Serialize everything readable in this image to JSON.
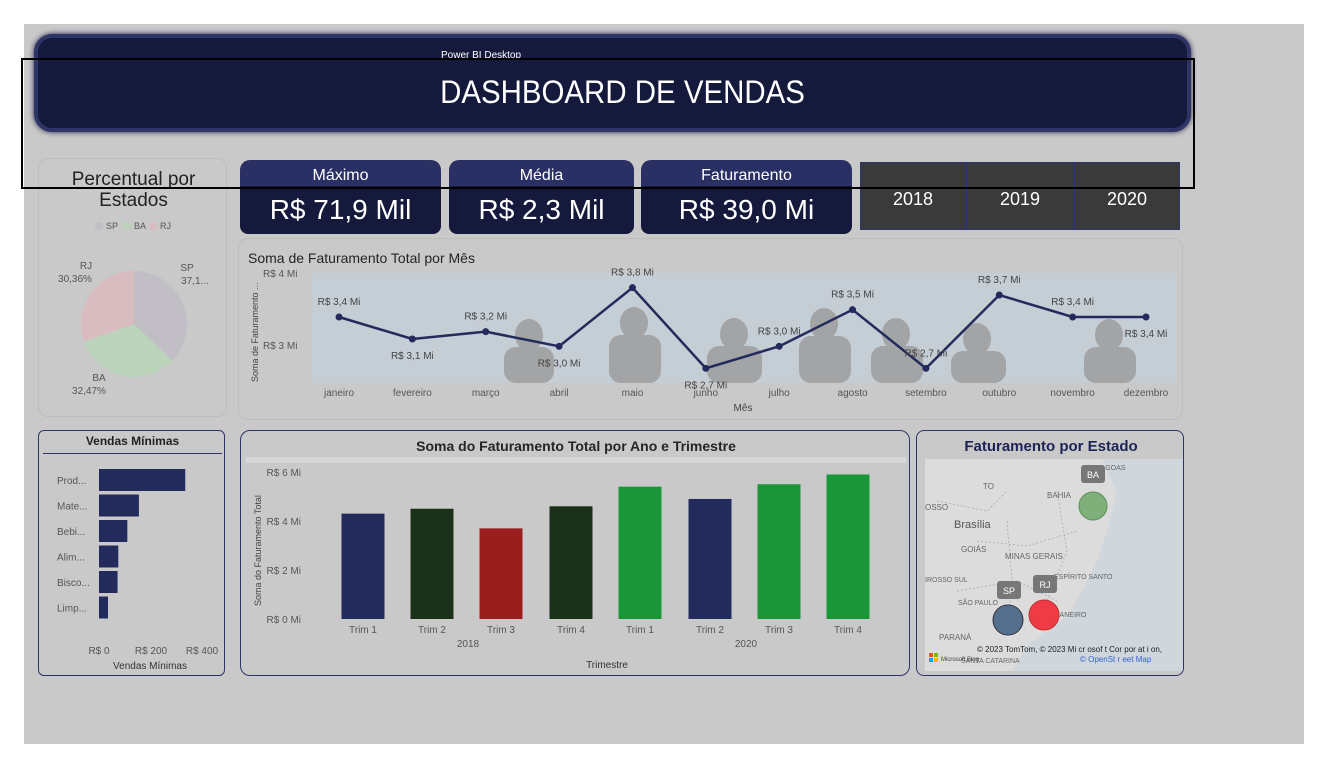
{
  "app": {
    "title": "Power BI Desktop"
  },
  "header": {
    "title": "DASHBOARD DE VENDAS"
  },
  "kpis": [
    {
      "label": "Máximo",
      "value": "R$ 71,9 Mil"
    },
    {
      "label": "Média",
      "value": "R$ 2,3 Mil"
    },
    {
      "label": "Faturamento",
      "value": "R$ 39,0 Mi"
    }
  ],
  "year_slicer": [
    "2018",
    "2019",
    "2020"
  ],
  "colors": {
    "navy": "#232a5c",
    "dark_green": "#1b3019",
    "red": "#9a1e1e",
    "green": "#1a9638",
    "header": "#151a3c"
  },
  "pie": {
    "title": "Percentual por Estados",
    "legend": [
      {
        "name": "SP",
        "color": "#c1bec6"
      },
      {
        "name": "BA",
        "color": "#bcd4bc"
      },
      {
        "name": "RJ",
        "color": "#d8bcbf"
      }
    ],
    "labels": {
      "sp": "SP",
      "sp_value": "37,1...",
      "rj": "RJ",
      "rj_value": "30,36%",
      "ba": "BA",
      "ba_value": "32,47%"
    }
  },
  "line": {
    "title": "Soma de Faturamento Total por Mês",
    "ylabel": "Soma de Faturamento ...",
    "xlabel": "Mês",
    "yticks": [
      "R$ 4 Mi",
      "R$ 3 Mi"
    ]
  },
  "bars_min": {
    "title": "Vendas Mínimas",
    "xlabel": "Vendas Mínimas",
    "xticks": [
      "R$ 0",
      "R$ 200",
      "R$ 400"
    ]
  },
  "bars_tri": {
    "title": "Soma do Faturamento Total por Ano e Trimestre",
    "ylabel": "Soma do Faturamento Total",
    "xlabel": "Trimestre",
    "yticks": [
      "R$ 6 Mi",
      "R$ 4 Mi",
      "R$ 2 Mi",
      "R$ 0 Mi"
    ],
    "years": [
      "2018",
      "2020"
    ]
  },
  "map": {
    "title": "Faturamento por Estado",
    "places": [
      "TO",
      "BAHIA",
      "ALAGOAS",
      "OSSO",
      "Brasília",
      "GOIÁS",
      "MINAS GERAIS",
      "ESPÍRITO SANTO",
      "IROSSO SUL",
      "SÃO PAULO",
      "RIO DE JANEIRO",
      "PARANÁ",
      "SANTA CATARINA"
    ],
    "markers": [
      "BA",
      "SP",
      "RJ"
    ],
    "attribution": "© 2023 TomTom, © 2023 Mi cr osof t Cor por at i on,",
    "osm": "© OpenSt r eet Map",
    "brand": "Microsoft Bing"
  },
  "chart_data": [
    {
      "type": "pie",
      "title": "Percentual por Estados",
      "slices": [
        {
          "name": "SP",
          "value": 37.17
        },
        {
          "name": "BA",
          "value": 32.47
        },
        {
          "name": "RJ",
          "value": 30.36
        }
      ]
    },
    {
      "type": "line",
      "title": "Soma de Faturamento Total por Mês",
      "xlabel": "Mês",
      "ylabel": "Soma de Faturamento ...",
      "categories": [
        "janeiro",
        "fevereiro",
        "março",
        "abril",
        "maio",
        "junho",
        "julho",
        "agosto",
        "setembro",
        "outubro",
        "novembro",
        "dezembro"
      ],
      "values": [
        3.4,
        3.1,
        3.2,
        3.0,
        3.8,
        2.7,
        3.0,
        3.5,
        2.7,
        3.7,
        3.4,
        3.4
      ],
      "value_labels": [
        "R$ 3,4 Mi",
        "R$ 3,1 Mi",
        "R$ 3,2 Mi",
        "R$ 3,0 Mi",
        "R$ 3,8 Mi",
        "R$ 2,7 Mi",
        "R$ 3,0 Mi",
        "R$ 3,5 Mi",
        "R$ 2,7 Mi",
        "R$ 3,7 Mi",
        "R$ 3,4 Mi",
        "R$ 3,4 Mi"
      ],
      "ylim": [
        2.5,
        4.0
      ]
    },
    {
      "type": "bar",
      "title": "Vendas Mínimas",
      "orientation": "horizontal",
      "categories": [
        "Prod...",
        "Mate...",
        "Bebi...",
        "Alim...",
        "Bisco...",
        "Limp..."
      ],
      "values": [
        335,
        155,
        110,
        75,
        72,
        35
      ],
      "xlabel": "Vendas Mínimas",
      "xlim": [
        0,
        450
      ]
    },
    {
      "type": "bar",
      "title": "Soma do Faturamento Total por Ano e Trimestre",
      "xlabel": "Trimestre",
      "ylabel": "Soma do Faturamento Total",
      "categories": [
        "Trim 1",
        "Trim 2",
        "Trim 3",
        "Trim 4",
        "Trim 1",
        "Trim 2",
        "Trim 3",
        "Trim 4"
      ],
      "groups": [
        "2018",
        "2018",
        "2018",
        "2018",
        "2020",
        "2020",
        "2020",
        "2020"
      ],
      "values": [
        4.3,
        4.5,
        3.7,
        4.6,
        5.4,
        4.9,
        5.5,
        5.9
      ],
      "ylim": [
        0,
        6
      ]
    }
  ]
}
